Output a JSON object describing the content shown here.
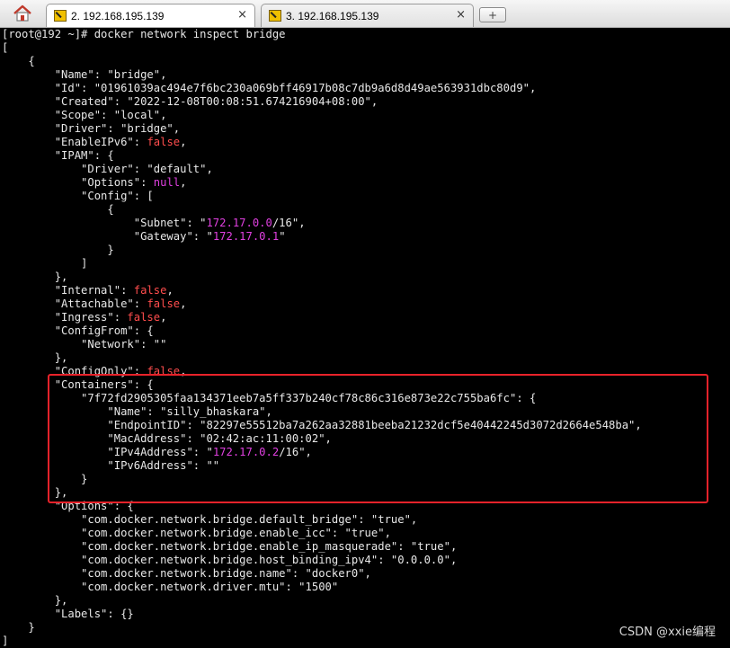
{
  "tabs": [
    {
      "label": "2. 192.168.195.139",
      "close": "×",
      "active": true
    },
    {
      "label": "3. 192.168.195.139",
      "close": "×",
      "active": false
    }
  ],
  "newtab_label": "+",
  "terminal": {
    "lines": [
      [
        {
          "t": "[root@192 ~]# docker network inspect bridge",
          "c": "t-c"
        }
      ],
      [
        {
          "t": "[",
          "c": "t-c"
        }
      ],
      [
        {
          "t": "    {",
          "c": "t-c"
        }
      ],
      [
        {
          "t": "        \"Name\": \"bridge\",",
          "c": "t-c"
        }
      ],
      [
        {
          "t": "        \"Id\": \"01961039ac494e7f6bc230a069bff46917b08c7db9a6d8d49ae563931dbc80d9\",",
          "c": "t-c"
        }
      ],
      [
        {
          "t": "        \"Created\": \"2022-12-08T00:08:51.674216904+08:00\",",
          "c": "t-c"
        }
      ],
      [
        {
          "t": "        \"Scope\": \"local\",",
          "c": "t-c"
        }
      ],
      [
        {
          "t": "        \"Driver\": \"bridge\",",
          "c": "t-c"
        }
      ],
      [
        {
          "t": "        \"EnableIPv6\": ",
          "c": "t-c"
        },
        {
          "t": "false",
          "c": "t-f"
        },
        {
          "t": ",",
          "c": "t-c"
        }
      ],
      [
        {
          "t": "        \"IPAM\": {",
          "c": "t-c"
        }
      ],
      [
        {
          "t": "            \"Driver\": \"default\",",
          "c": "t-c"
        }
      ],
      [
        {
          "t": "            \"Options\": ",
          "c": "t-c"
        },
        {
          "t": "null",
          "c": "t-n"
        },
        {
          "t": ",",
          "c": "t-c"
        }
      ],
      [
        {
          "t": "            \"Config\": [",
          "c": "t-c"
        }
      ],
      [
        {
          "t": "                {",
          "c": "t-c"
        }
      ],
      [
        {
          "t": "                    \"Subnet\": \"",
          "c": "t-c"
        },
        {
          "t": "172.17.0.0",
          "c": "t-n"
        },
        {
          "t": "/16\",",
          "c": "t-c"
        }
      ],
      [
        {
          "t": "                    \"Gateway\": \"",
          "c": "t-c"
        },
        {
          "t": "172.17.0.1",
          "c": "t-n"
        },
        {
          "t": "\"",
          "c": "t-c"
        }
      ],
      [
        {
          "t": "                }",
          "c": "t-c"
        }
      ],
      [
        {
          "t": "            ]",
          "c": "t-c"
        }
      ],
      [
        {
          "t": "        },",
          "c": "t-c"
        }
      ],
      [
        {
          "t": "        \"Internal\": ",
          "c": "t-c"
        },
        {
          "t": "false",
          "c": "t-f"
        },
        {
          "t": ",",
          "c": "t-c"
        }
      ],
      [
        {
          "t": "        \"Attachable\": ",
          "c": "t-c"
        },
        {
          "t": "false",
          "c": "t-f"
        },
        {
          "t": ",",
          "c": "t-c"
        }
      ],
      [
        {
          "t": "        \"Ingress\": ",
          "c": "t-c"
        },
        {
          "t": "false",
          "c": "t-f"
        },
        {
          "t": ",",
          "c": "t-c"
        }
      ],
      [
        {
          "t": "        \"ConfigFrom\": {",
          "c": "t-c"
        }
      ],
      [
        {
          "t": "            \"Network\": \"\"",
          "c": "t-c"
        }
      ],
      [
        {
          "t": "        },",
          "c": "t-c"
        }
      ],
      [
        {
          "t": "        \"ConfigOnly\": ",
          "c": "t-c"
        },
        {
          "t": "false",
          "c": "t-f"
        },
        {
          "t": ",",
          "c": "t-c"
        }
      ],
      [
        {
          "t": "        \"Containers\": {",
          "c": "t-c"
        }
      ],
      [
        {
          "t": "            \"7f72fd2905305faa134371eeb7a5ff337b240cf78c86c316e873e22c755ba6fc\": {",
          "c": "t-c"
        }
      ],
      [
        {
          "t": "                \"Name\": \"silly_bhaskara\",",
          "c": "t-c"
        }
      ],
      [
        {
          "t": "                \"EndpointID\": \"82297e55512ba7a262aa32881beeba21232dcf5e40442245d3072d2664e548ba\",",
          "c": "t-c"
        }
      ],
      [
        {
          "t": "                \"MacAddress\": \"02:42:ac:11:00:02\",",
          "c": "t-c"
        }
      ],
      [
        {
          "t": "                \"IPv4Address\": \"",
          "c": "t-c"
        },
        {
          "t": "172.17.0.2",
          "c": "t-n"
        },
        {
          "t": "/16\",",
          "c": "t-c"
        }
      ],
      [
        {
          "t": "                \"IPv6Address\": \"\"",
          "c": "t-c"
        }
      ],
      [
        {
          "t": "            }",
          "c": "t-c"
        }
      ],
      [
        {
          "t": "        },",
          "c": "t-c"
        }
      ],
      [
        {
          "t": "        \"Options\": {",
          "c": "t-c"
        }
      ],
      [
        {
          "t": "            \"com.docker.network.bridge.default_bridge\": \"true\",",
          "c": "t-c"
        }
      ],
      [
        {
          "t": "            \"com.docker.network.bridge.enable_icc\": \"true\",",
          "c": "t-c"
        }
      ],
      [
        {
          "t": "            \"com.docker.network.bridge.enable_ip_masquerade\": \"true\",",
          "c": "t-c"
        }
      ],
      [
        {
          "t": "            \"com.docker.network.bridge.host_binding_ipv4\": \"0.0.0.0\",",
          "c": "t-c"
        }
      ],
      [
        {
          "t": "            \"com.docker.network.bridge.name\": \"docker0\",",
          "c": "t-c"
        }
      ],
      [
        {
          "t": "            \"com.docker.network.driver.mtu\": \"1500\"",
          "c": "t-c"
        }
      ],
      [
        {
          "t": "        },",
          "c": "t-c"
        }
      ],
      [
        {
          "t": "        \"Labels\": {}",
          "c": "t-c"
        }
      ],
      [
        {
          "t": "    }",
          "c": "t-c"
        }
      ],
      [
        {
          "t": "]",
          "c": "t-c"
        }
      ]
    ]
  },
  "watermark": "CSDN @xxie编程",
  "colors": {
    "background": "#000000",
    "text": "#e8e8e8",
    "false_literal": "#ff4d4d",
    "ip_null_literal": "#e040e0",
    "highlight_box": "#e8222a"
  }
}
